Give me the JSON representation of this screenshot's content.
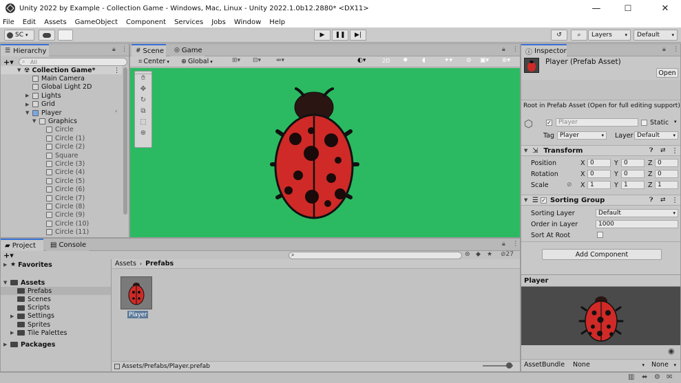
{
  "window": {
    "title": "Unity 2022 by Example - Collection Game - Windows, Mac, Linux - Unity 2022.1.0b12.2880* <DX11>",
    "minimize": "—",
    "maximize": "☐",
    "close": "✕"
  },
  "menu": [
    "File",
    "Edit",
    "Assets",
    "GameObject",
    "Component",
    "Services",
    "Jobs",
    "Window",
    "Help"
  ],
  "toolbar": {
    "account": "SC",
    "layers": "Layers",
    "layout": "Default"
  },
  "hierarchy": {
    "tab": "Hierarchy",
    "search_placeholder": "All",
    "items": [
      {
        "label": "Collection Game*",
        "depth": 0,
        "bold": true
      },
      {
        "label": "Main Camera",
        "depth": 1
      },
      {
        "label": "Global Light 2D",
        "depth": 1
      },
      {
        "label": "Lights",
        "depth": 1,
        "expandable": true
      },
      {
        "label": "Grid",
        "depth": 1,
        "expandable": true
      },
      {
        "label": "Player",
        "depth": 1,
        "expanded": true,
        "prefab": true
      },
      {
        "label": "Graphics",
        "depth": 2,
        "expanded": true
      },
      {
        "label": "Circle",
        "depth": 3
      },
      {
        "label": "Circle (1)",
        "depth": 3
      },
      {
        "label": "Circle (2)",
        "depth": 3
      },
      {
        "label": "Square",
        "depth": 3
      },
      {
        "label": "Circle (3)",
        "depth": 3
      },
      {
        "label": "Circle (4)",
        "depth": 3
      },
      {
        "label": "Circle (5)",
        "depth": 3
      },
      {
        "label": "Circle (6)",
        "depth": 3
      },
      {
        "label": "Circle (7)",
        "depth": 3
      },
      {
        "label": "Circle (8)",
        "depth": 3
      },
      {
        "label": "Circle (9)",
        "depth": 3
      },
      {
        "label": "Circle (10)",
        "depth": 3
      },
      {
        "label": "Circle (11)",
        "depth": 3
      }
    ]
  },
  "scene": {
    "tabs": [
      "Scene",
      "Game"
    ],
    "pivot": "Center",
    "space": "Global",
    "mode2d": "2D",
    "background": "#2bba62"
  },
  "project": {
    "tabs": [
      "Project",
      "Console"
    ],
    "count": "27",
    "favorites": "Favorites",
    "tree": [
      {
        "label": "Assets",
        "depth": 0
      },
      {
        "label": "Prefabs",
        "depth": 1,
        "selected": true
      },
      {
        "label": "Scenes",
        "depth": 1
      },
      {
        "label": "Scripts",
        "depth": 1
      },
      {
        "label": "Settings",
        "depth": 1
      },
      {
        "label": "Sprites",
        "depth": 1
      },
      {
        "label": "Tile Palettes",
        "depth": 1
      },
      {
        "label": "Packages",
        "depth": 0
      }
    ],
    "breadcrumb": [
      "Assets",
      "Prefabs"
    ],
    "asset_label": "Player",
    "path": "Assets/Prefabs/Player.prefab"
  },
  "inspector": {
    "tab": "Inspector",
    "asset_title": "Player (Prefab Asset)",
    "open": "Open",
    "notice": "Root in Prefab Asset (Open for full editing support)",
    "name": "Player",
    "static": "Static",
    "tag_label": "Tag",
    "tag": "Player",
    "layer_label": "Layer",
    "layer": "Default",
    "transform": {
      "title": "Transform",
      "rows": [
        {
          "label": "Position",
          "x": "0",
          "y": "0",
          "z": "0"
        },
        {
          "label": "Rotation",
          "x": "0",
          "y": "0",
          "z": "0"
        },
        {
          "label": "Scale",
          "x": "1",
          "y": "1",
          "z": "1"
        }
      ]
    },
    "sorting": {
      "title": "Sorting Group",
      "layer_label": "Sorting Layer",
      "layer": "Default",
      "order_label": "Order in Layer",
      "order": "1000",
      "root_label": "Sort At Root"
    },
    "add_component": "Add Component",
    "preview_title": "Player",
    "assetbundle_label": "AssetBundle",
    "assetbundle": "None",
    "variant": "None"
  }
}
